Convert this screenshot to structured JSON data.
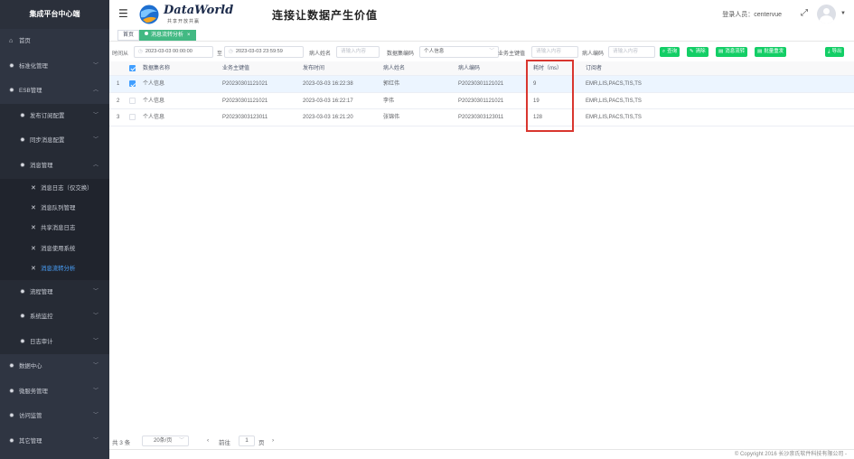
{
  "sidebar": {
    "brand": "集成平台中心端",
    "items": [
      {
        "label": "首页"
      },
      {
        "label": "标准化管理"
      },
      {
        "label": "ESB管理"
      },
      {
        "label": "发布订阅配置"
      },
      {
        "label": "同步消息配置"
      },
      {
        "label": "消息管理"
      },
      {
        "label": "消息日志（仅交换）"
      },
      {
        "label": "消息队列管理"
      },
      {
        "label": "共享消息日志"
      },
      {
        "label": "消息使用系统"
      },
      {
        "label": "消息流转分析"
      },
      {
        "label": "流程管理"
      },
      {
        "label": "系统监控"
      },
      {
        "label": "日志审计"
      },
      {
        "label": "数据中心"
      },
      {
        "label": "微服务管理"
      },
      {
        "label": "访问监管"
      },
      {
        "label": "其它管理"
      }
    ]
  },
  "header": {
    "logo_text": "DataWorld",
    "logo_tag": "共享开放共赢",
    "slogan": "连接让数据产生价值",
    "login_label": "登录人员：",
    "login_user": "centervue"
  },
  "tabs": [
    {
      "label": "首页"
    },
    {
      "label": "消息流转分析"
    }
  ],
  "filters": {
    "time_from_label": "时间从",
    "time_from": "2023-03-03 00:00:00",
    "to_label": "至",
    "time_to": "2023-03-03 23:59:59",
    "patient_name_label": "病人姓名",
    "patient_name_placeholder": "请输入内容",
    "dataset_code_label": "数据集编码",
    "dataset_code_value": "个人信息",
    "business_key_label": "业务主键值",
    "business_key_placeholder": "请输入内容",
    "patient_code_label": "病人编码",
    "patient_code_placeholder": "请输入内容",
    "btn_search": "查询",
    "btn_reset": "清除",
    "btn_flow": "消息流转",
    "btn_batch": "批量重发",
    "btn_export": "导出"
  },
  "table": {
    "headers": [
      "数据集名称",
      "业务主键值",
      "发布时间",
      "病人姓名",
      "病人编码",
      "耗时（ms）",
      "订阅者"
    ],
    "rows": [
      {
        "index": "1",
        "name": "个人信息",
        "key": "P20230301121021",
        "time": "2023-03-03 16:22:38",
        "patient": "郭红伟",
        "code": "P20230301121021",
        "cost": "9",
        "subscribers": "EMR,LIS,PACS,TIS,TS"
      },
      {
        "index": "2",
        "name": "个人信息",
        "key": "P20230301121021",
        "time": "2023-03-03 16:22:17",
        "patient": "李伟",
        "code": "P20230301121021",
        "cost": "19",
        "subscribers": "EMR,LIS,PACS,TIS,TS"
      },
      {
        "index": "3",
        "name": "个人信息",
        "key": "P20230303123011",
        "time": "2023-03-03 16:21:20",
        "patient": "张锦伟",
        "code": "P20230303123011",
        "cost": "128",
        "subscribers": "EMR,LIS,PACS,TIS,TS"
      }
    ]
  },
  "pager": {
    "total": "共 3 条",
    "page_size": "20条/页",
    "goto_label": "前往",
    "page": "1",
    "page_unit": "页"
  },
  "copyright": "© Copyright 2016 长沙崇氏软件科技有限公司 -",
  "colors": {
    "accent": "#42b983",
    "button": "#13ce66",
    "highlight": "#d9362f",
    "sidebar": "#2f3542"
  }
}
